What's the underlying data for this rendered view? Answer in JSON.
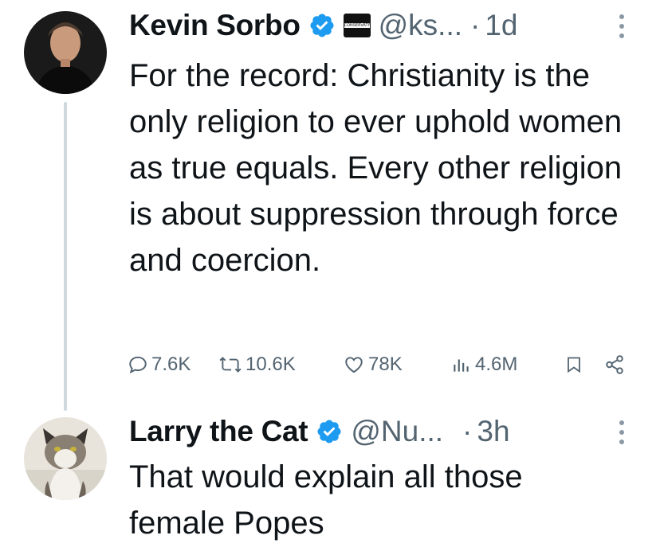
{
  "tweets": [
    {
      "name": "Kevin Sorbo",
      "handle": "@ks...",
      "separator": "·",
      "time": "1d",
      "affiliate_badge_text": "CONSERVATIVE",
      "text": "For the record: Christianity is the only religion to ever uphold women as true equals. Every other religion is about suppression through force and coercion.",
      "actions": {
        "replies": "7.6K",
        "reposts": "10.6K",
        "likes": "78K",
        "views": "4.6M"
      }
    },
    {
      "name": "Larry the Cat",
      "handle": "@Nu...",
      "separator": "·",
      "time": "3h",
      "text": "That would explain all those female Popes"
    }
  ],
  "colors": {
    "verified": "#1d9bf0",
    "secondary_text": "#536471",
    "primary_text": "#0f1419",
    "thread_line": "#cfd9de"
  },
  "icons": [
    "verified-badge-icon",
    "affiliate-badge-icon",
    "more-options-icon",
    "reply-icon",
    "repost-icon",
    "like-icon",
    "views-icon",
    "bookmark-icon",
    "share-icon"
  ]
}
